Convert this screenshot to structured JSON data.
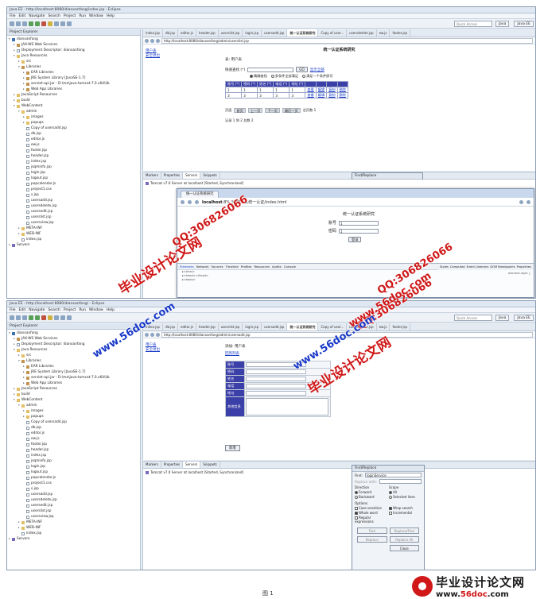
{
  "shot1": {
    "window_title": "Java EE - http://localhost:8080/dianxanfang/index.jsp - Eclipse",
    "menu": [
      "File",
      "Edit",
      "Navigate",
      "Search",
      "Project",
      "Run",
      "Window",
      "Help"
    ],
    "quick_access": "Quick Access",
    "perspective_label": "Java",
    "perspective_ee_label": "Java EE",
    "explorer_title": "Project Explorer",
    "editor_tabs": [
      "index.jsp",
      "db.jsp",
      "editor.js",
      "header.jsp",
      "userslist.jsp",
      "login.jsp",
      "usersadd.jsp",
      "统一认证系统研究",
      "Copy of user...",
      "usersdelete.jsp",
      "ew.js",
      "footer.jsp"
    ],
    "url": "http://localhost:8080/dianxanfang/admin/userslist.jsp",
    "side_links": [
      "用户表",
      "安全退出"
    ],
    "system_title": "统一认证系统研究",
    "section_label": "表: 用户表",
    "query_label": "快速查找 (*)",
    "query_button": "GO",
    "show_all_link": "显示全部",
    "radio_options": [
      "精确查找",
      "多条件全部满足",
      "满足一个条件即可"
    ],
    "table_headers": [
      "账号 (*)",
      "密码 (*)",
      "姓名 (*)",
      "电话 (*)",
      "地址 (*)",
      "",
      "",
      "",
      ""
    ],
    "table_rows": [
      [
        "1",
        "1",
        "1",
        "1",
        "1",
        "查看",
        "编辑",
        "复制",
        "删除"
      ],
      [
        "3",
        "3",
        "3",
        "3",
        "3",
        "查看",
        "编辑",
        "复制",
        "删除"
      ]
    ],
    "pager_label": "页面",
    "pager_buttons": [
      "首页",
      "上一页",
      "下一页",
      "最后一页"
    ],
    "pager_suffix": "总页数 1",
    "record_text": "记录 1 到 2 总数 2",
    "panel_tabs": [
      "Markers",
      "Properties",
      "Servers",
      "Snippets"
    ],
    "server_line": "Tomcat v7.0 Server at localhost [Started, Synchronized]",
    "find_title": "Find/Replace",
    "chrome_tab": "统一认证系统研究",
    "chrome_url_host": "localhost",
    "chrome_url_path": ":8%,%/统三认统一认证/index.html",
    "login_title": "统一认证系统研究",
    "login_account_label": "账号",
    "login_account_value": "1",
    "login_password_label": "密码",
    "login_password_value": "1",
    "login_button": "登录",
    "devtools_tabs": [
      "Elements",
      "Network",
      "Sources",
      "Timeline",
      "Profiles",
      "Resources",
      "Audits",
      "Console"
    ],
    "devtools_lines": [
      "▸<html>",
      "  ▸<head></head>",
      "  ▸<body>"
    ],
    "styles_tabs": [
      "Styles",
      "Computed",
      "Event Listeners",
      "DOM Breakpoints",
      "Properties"
    ],
    "styles_line": "element.style {"
  },
  "shot2": {
    "window_title": "Java EE - http://localhost:8080/dianxanfang/ - Eclipse",
    "menu": [
      "File",
      "Edit",
      "Navigate",
      "Search",
      "Project",
      "Run",
      "Window",
      "Help"
    ],
    "quick_access": "Quick Access",
    "perspective_label": "Java",
    "perspective_ee_label": "Java EE",
    "explorer_title": "Project Explorer",
    "editor_tabs": [
      "index.jsp",
      "db.jsp",
      "editor.js",
      "header.jsp",
      "userslist.jsp",
      "login.jsp",
      "usersadd.jsp",
      "统一认证系统研究",
      "Copy of user...",
      "usersdelete.jsp",
      "ew.js",
      "footer.jsp"
    ],
    "url": "http://localhost:8080/dianxanfang/admin/usersadd.jsp",
    "side_links": [
      "用户表",
      "安全退出"
    ],
    "form_title": "添加: 用户表",
    "back_link": "回到列表",
    "form_fields": [
      "账号",
      "密码",
      "姓名",
      "电话",
      "地址",
      "其他信息"
    ],
    "add_button": "新增",
    "panel_tabs": [
      "Markers",
      "Properties",
      "Servers",
      "Snippets"
    ],
    "server_line": "Tomcat v7.0 Server at localhost [Started, Synchronized]",
    "find_title": "Find/Replace",
    "find_label": "Find:",
    "find_value": "loginService",
    "replace_label": "Replace with:",
    "direction_label": "Direction",
    "scope_label": "Scope",
    "direction_options": [
      "Forward",
      "Backward"
    ],
    "scope_options": [
      "All",
      "Selected lines"
    ],
    "options_label": "Options",
    "options": [
      "Case sensitive",
      "Wrap search",
      "Whole word",
      "Incremental",
      "Regular expressions"
    ],
    "buttons": [
      "Find",
      "Replace/Find",
      "Replace",
      "Replace All"
    ],
    "close_button": "Close"
  },
  "tree": [
    {
      "indent": 0,
      "icon": "project",
      "label": "dianxanfang",
      "twisty": "▾"
    },
    {
      "indent": 1,
      "icon": "lib",
      "label": "JAX-WS Web Services",
      "twisty": "▸"
    },
    {
      "indent": 1,
      "icon": "file",
      "label": "Deployment Descriptor: dianxanfang",
      "twisty": "▸"
    },
    {
      "indent": 1,
      "icon": "folder",
      "label": "Java Resources",
      "twisty": "▾"
    },
    {
      "indent": 2,
      "icon": "folder",
      "label": "src",
      "twisty": "▸"
    },
    {
      "indent": 2,
      "icon": "lib",
      "label": "Libraries",
      "twisty": "▾"
    },
    {
      "indent": 3,
      "icon": "lib",
      "label": "EAR Libraries",
      "twisty": "▸"
    },
    {
      "indent": 3,
      "icon": "lib",
      "label": "JRE System Library [JavaSE-1.7]",
      "twisty": "▸"
    },
    {
      "indent": 3,
      "icon": "lib",
      "label": "servlet-api.jar - D:\\me\\java-tomcat-7.0.x64\\lib",
      "twisty": "▸"
    },
    {
      "indent": 3,
      "icon": "lib",
      "label": "Web App Libraries",
      "twisty": "▸"
    },
    {
      "indent": 1,
      "icon": "folder",
      "label": "JavaScript Resources",
      "twisty": "▸"
    },
    {
      "indent": 1,
      "icon": "folder",
      "label": "build",
      "twisty": "▸"
    },
    {
      "indent": 1,
      "icon": "folder",
      "label": "WebContent",
      "twisty": "▾"
    },
    {
      "indent": 2,
      "icon": "folder",
      "label": "admin",
      "twisty": "▾"
    },
    {
      "indent": 3,
      "icon": "folder",
      "label": "images",
      "twisty": "▸"
    },
    {
      "indent": 3,
      "icon": "folder",
      "label": "popups",
      "twisty": "▸"
    },
    {
      "indent": 3,
      "icon": "file",
      "label": "Copy of usersadd.jsp",
      "twisty": ""
    },
    {
      "indent": 3,
      "icon": "file",
      "label": "db.jsp",
      "twisty": ""
    },
    {
      "indent": 3,
      "icon": "file",
      "label": "editor.js",
      "twisty": ""
    },
    {
      "indent": 3,
      "icon": "file",
      "label": "ew.js",
      "twisty": ""
    },
    {
      "indent": 3,
      "icon": "file",
      "label": "footer.jsp",
      "twisty": ""
    },
    {
      "indent": 3,
      "icon": "file",
      "label": "header.jsp",
      "twisty": ""
    },
    {
      "indent": 3,
      "icon": "file",
      "label": "index.jsp",
      "twisty": ""
    },
    {
      "indent": 3,
      "icon": "file",
      "label": "jsqminfo.jsp",
      "twisty": ""
    },
    {
      "indent": 3,
      "icon": "file",
      "label": "login.jsp",
      "twisty": ""
    },
    {
      "indent": 3,
      "icon": "file",
      "label": "logout.jsp",
      "twisty": ""
    },
    {
      "indent": 3,
      "icon": "file",
      "label": "popcalendar.js",
      "twisty": ""
    },
    {
      "indent": 3,
      "icon": "file",
      "label": "project1.css",
      "twisty": ""
    },
    {
      "indent": 3,
      "icon": "file",
      "label": "s.jsp",
      "twisty": ""
    },
    {
      "indent": 3,
      "icon": "file",
      "label": "usersadd.jsp",
      "twisty": ""
    },
    {
      "indent": 3,
      "icon": "file",
      "label": "usersdelete.jsp",
      "twisty": ""
    },
    {
      "indent": 3,
      "icon": "file",
      "label": "usersedit.jsp",
      "twisty": ""
    },
    {
      "indent": 3,
      "icon": "file",
      "label": "userslist.jsp",
      "twisty": ""
    },
    {
      "indent": 3,
      "icon": "file",
      "label": "usersview.jsp",
      "twisty": ""
    },
    {
      "indent": 2,
      "icon": "folder",
      "label": "META-INF",
      "twisty": "▸"
    },
    {
      "indent": 2,
      "icon": "folder",
      "label": "WEB-INF",
      "twisty": "▸"
    },
    {
      "indent": 2,
      "icon": "file",
      "label": "index.jsp",
      "twisty": ""
    },
    {
      "indent": 0,
      "icon": "server",
      "label": "Servers",
      "twisty": "▸"
    }
  ],
  "watermarks": {
    "site_cn": "毕业设计论文网",
    "site_url": "www.56doc.com",
    "qq": "QQ:306826066"
  },
  "footer": {
    "brand_cn": "毕业设计论文网",
    "brand_url_prefix": "www.",
    "brand_url_domain": "56doc",
    "brand_url_suffix": ".com",
    "caption": "图 1"
  },
  "colors": {
    "table_header": "#3b3fa8",
    "link": "#1a3ec8",
    "watermark_red": "#d01818",
    "watermark_blue": "#1838c8"
  }
}
